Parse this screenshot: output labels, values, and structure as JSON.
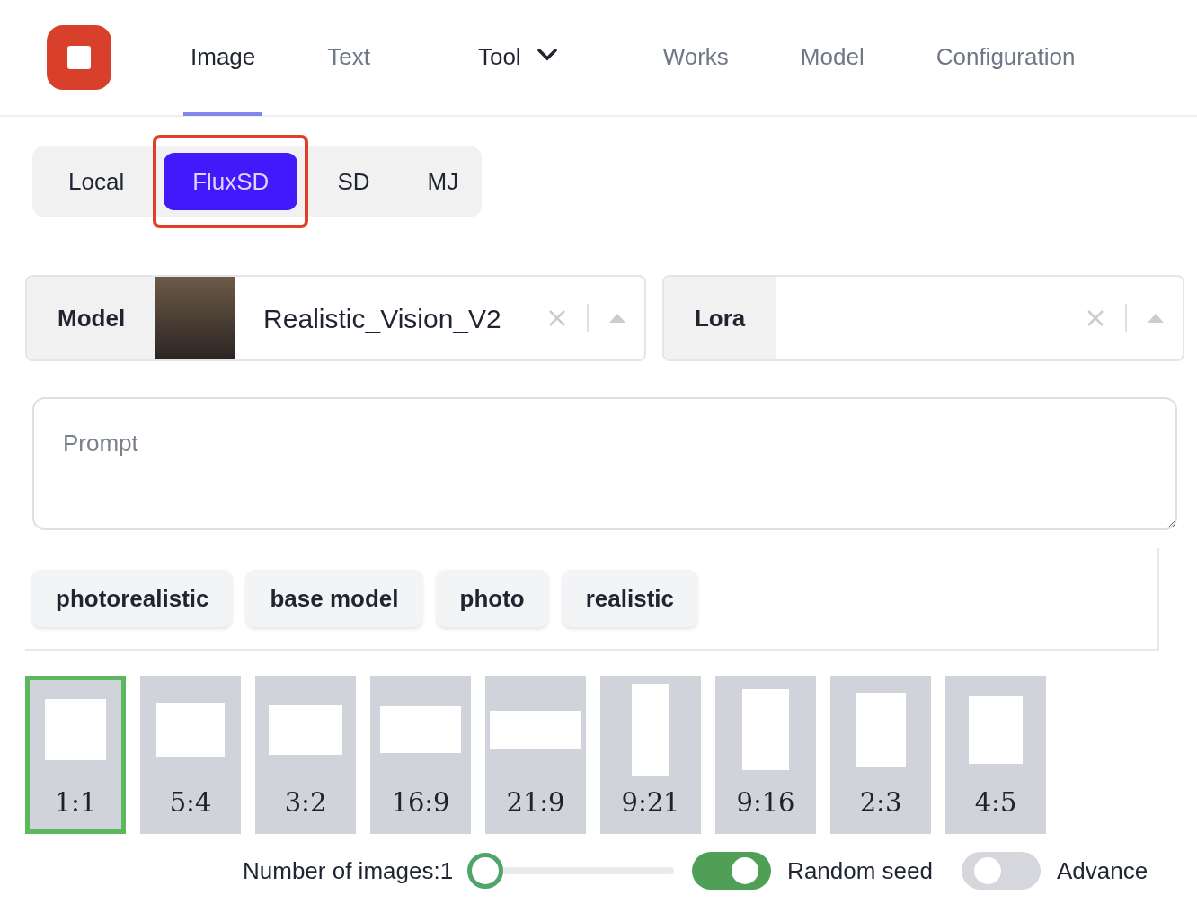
{
  "nav": [
    {
      "label": "Image",
      "kind": "link",
      "selected": true
    },
    {
      "label": "Text",
      "kind": "link",
      "selected": false
    },
    {
      "label": "Tool",
      "kind": "dropdown",
      "selected": false
    },
    {
      "label": "Works",
      "kind": "link",
      "selected": false
    },
    {
      "label": "Model",
      "kind": "link",
      "selected": false
    },
    {
      "label": "Configuration",
      "kind": "link",
      "selected": false
    }
  ],
  "source_tabs": [
    {
      "label": "Local",
      "selected": false,
      "highlighted": false
    },
    {
      "label": "FluxSD",
      "selected": true,
      "highlighted": true
    },
    {
      "label": "SD",
      "selected": false,
      "highlighted": false
    },
    {
      "label": "MJ",
      "selected": false,
      "highlighted": false
    }
  ],
  "model_select": {
    "label": "Model",
    "value": "Realistic_Vision_V2",
    "has_thumbnail": true
  },
  "lora_select": {
    "label": "Lora"
  },
  "prompt": {
    "placeholder": "Prompt"
  },
  "tags": [
    "photorealistic",
    "base model",
    "photo",
    "realistic"
  ],
  "aspect_ratios": [
    {
      "label": "1:1",
      "kind": "square",
      "selected": true
    },
    {
      "label": "5:4",
      "kind": "fivefour",
      "selected": false
    },
    {
      "label": "3:2",
      "kind": "threetwo",
      "selected": false
    },
    {
      "label": "16:9",
      "kind": "sixteennine",
      "selected": false
    },
    {
      "label": "21:9",
      "kind": "twentyonenine",
      "selected": false
    },
    {
      "label": "9:21",
      "kind": "ninetwentyone",
      "selected": false
    },
    {
      "label": "9:16",
      "kind": "ninesixteen",
      "selected": false
    },
    {
      "label": "2:3",
      "kind": "twothree",
      "selected": false
    },
    {
      "label": "4:5",
      "kind": "fourfive",
      "selected": false
    }
  ],
  "number_of_images": {
    "label": "Number of images:1",
    "level": 0
  },
  "toggles": [
    {
      "label": "Random seed",
      "on": true
    },
    {
      "label": "Advance",
      "on": false
    }
  ]
}
